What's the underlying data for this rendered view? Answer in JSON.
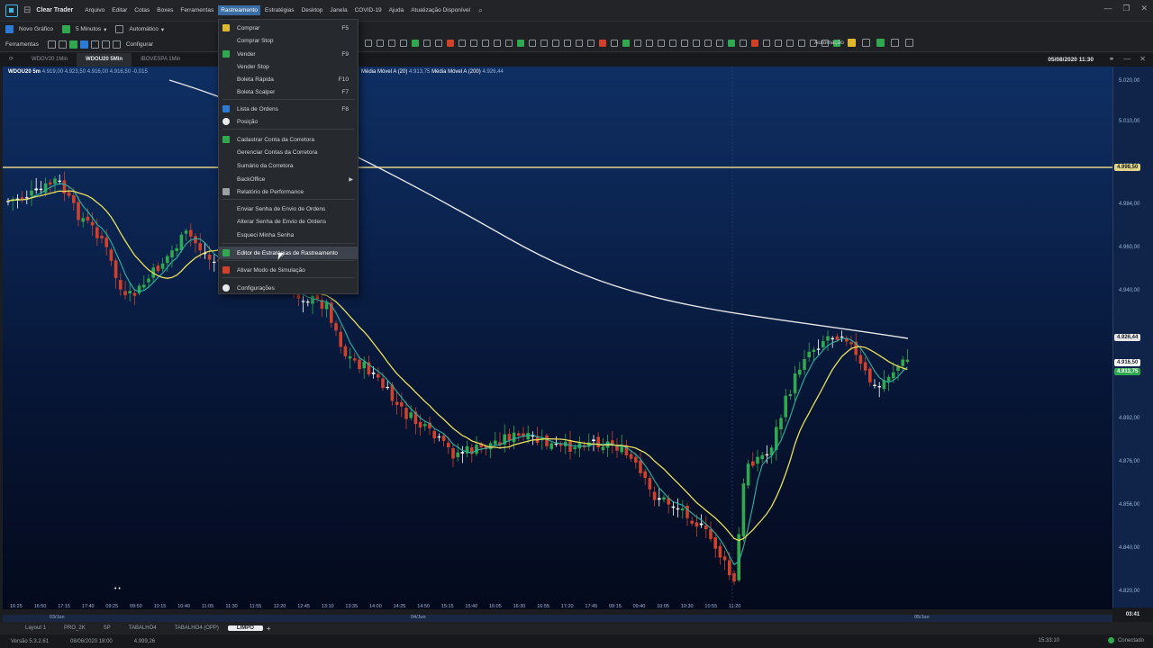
{
  "app": {
    "title": "Clear Trader",
    "menu": [
      "Arquivo",
      "Editar",
      "Cotas",
      "Boxes",
      "Ferramentas",
      "Rastreamento",
      "Estratégias",
      "Desktop",
      "Janela",
      "COVID-19",
      "Ajuda",
      "Atualização Disponível"
    ],
    "active_menu_index": 5
  },
  "toolbar1": {
    "new_chart": "Novo Gráfico",
    "timeframe": "5 Minutos",
    "mode": "Automático"
  },
  "toolbar2": {
    "tools_label": "Ferramentas",
    "config": "Configurar",
    "automation": "Automação"
  },
  "chart_tabs": [
    {
      "label": "WDOV20 1Min",
      "active": false
    },
    {
      "label": "WDOU20 5Min",
      "active": true
    },
    {
      "label": "IBOVESPA 1Min",
      "active": false
    }
  ],
  "datetime": "05/08/2020 11:30",
  "legend": {
    "symbol": "WDOU20 5m",
    "ohlc": "4.919,00 4.923,50 4.916,00 4.916,50 -0,015",
    "ma1_label": "Média Móvel A (20)",
    "ma1_value": "4.913,75",
    "ma2_label": "Média Móvel A (200)",
    "ma2_value": "4.926,44"
  },
  "dropdown": [
    {
      "label": "Comprar",
      "shortcut": "F5",
      "icon": "#e1b72b"
    },
    {
      "label": "Comprar Stop",
      "shortcut": "",
      "icon": ""
    },
    {
      "label": "Vender",
      "shortcut": "F9",
      "icon": "#2fa84f"
    },
    {
      "label": "Vender Stop",
      "shortcut": "",
      "icon": ""
    },
    {
      "label": "Boleta Rápida",
      "shortcut": "F10",
      "icon": ""
    },
    {
      "label": "Boleta Scalper",
      "shortcut": "F7",
      "icon": ""
    },
    {
      "label": "Lista de Ordens",
      "shortcut": "F8",
      "icon": "#2b7bd6"
    },
    {
      "label": "Posição",
      "shortcut": "",
      "icon": "#e8eaed"
    },
    {
      "label": "Cadastrar Conta da Corretora",
      "shortcut": "",
      "icon": "#2fa84f"
    },
    {
      "label": "Gerenciar Contas da Corretora",
      "shortcut": "",
      "icon": ""
    },
    {
      "label": "Sumário da Corretora",
      "shortcut": "",
      "icon": ""
    },
    {
      "label": "BackOffice",
      "shortcut": "▶",
      "icon": ""
    },
    {
      "label": "Relatório de Performance",
      "shortcut": "",
      "icon": "#9aa0a6"
    },
    {
      "label": "Enviar Senha de Envio de Ordens",
      "shortcut": "",
      "icon": ""
    },
    {
      "label": "Alterar Senha de Envio de Ordens",
      "shortcut": "",
      "icon": ""
    },
    {
      "label": "Esqueci Minha Senha",
      "shortcut": "",
      "icon": ""
    },
    {
      "label": "Editor de Estratégias de Rastreamento",
      "shortcut": "",
      "icon": "#2fa84f"
    },
    {
      "label": "Ativar Modo de Simulação",
      "shortcut": "",
      "icon": "#d0412b"
    },
    {
      "label": "Configurações",
      "shortcut": "",
      "icon": "#e8eaed"
    }
  ],
  "price_axis": {
    "labels": [
      "5.020,00",
      "5.010,00",
      "4.992,00",
      "4.984,00",
      "4.960,00",
      "4.940,00",
      "4.920,00",
      "4.892,00",
      "4.876,00",
      "4.856,00",
      "4.840,00",
      "4.820,00"
    ],
    "tag_upper": "4.998,50",
    "tag_ma200": "4.926,44",
    "tag_last": "4.916,50",
    "tag_ma20": "4.913,75"
  },
  "time_axis": {
    "labels": [
      "16:25",
      "16:50",
      "17:15",
      "17:40",
      "09:25",
      "09:50",
      "10:15",
      "10:40",
      "11:05",
      "11:30",
      "11:55",
      "12:20",
      "12:45",
      "13:10",
      "13:35",
      "14:00",
      "14:25",
      "14:50",
      "15:15",
      "15:40",
      "16:05",
      "16:30",
      "16:55",
      "17:20",
      "17:45",
      "09:15",
      "09:40",
      "10:05",
      "10:30",
      "10:55",
      "11:20"
    ],
    "date_markers": [
      "03/Jun",
      "04/Jun",
      "05/Jun"
    ],
    "corner": "03:41"
  },
  "workspaces": [
    {
      "label": "Layout 1",
      "active": false
    },
    {
      "label": "PRO_2K",
      "active": false
    },
    {
      "label": "SP",
      "active": false
    },
    {
      "label": "TABALHO4",
      "active": false
    },
    {
      "label": "TABALHO4 (OPP)",
      "active": false
    },
    {
      "label": "LIMPO",
      "active": true
    }
  ],
  "status": {
    "version": "Versão 5.3.2.61",
    "date_info": "08/06/2020 18:00",
    "price_info": "4.999,26",
    "clock": "15:33:10",
    "connection": "Conectado"
  },
  "colors": {
    "accent": "#3a6ea5",
    "bull": "#2fa84f",
    "bear": "#d0412b",
    "doji": "#ffffff",
    "ma20": "#e8e05a",
    "ma_fast": "#2bb5a0",
    "ma200": "#e6e6e6",
    "hline": "#e1d58a"
  }
}
